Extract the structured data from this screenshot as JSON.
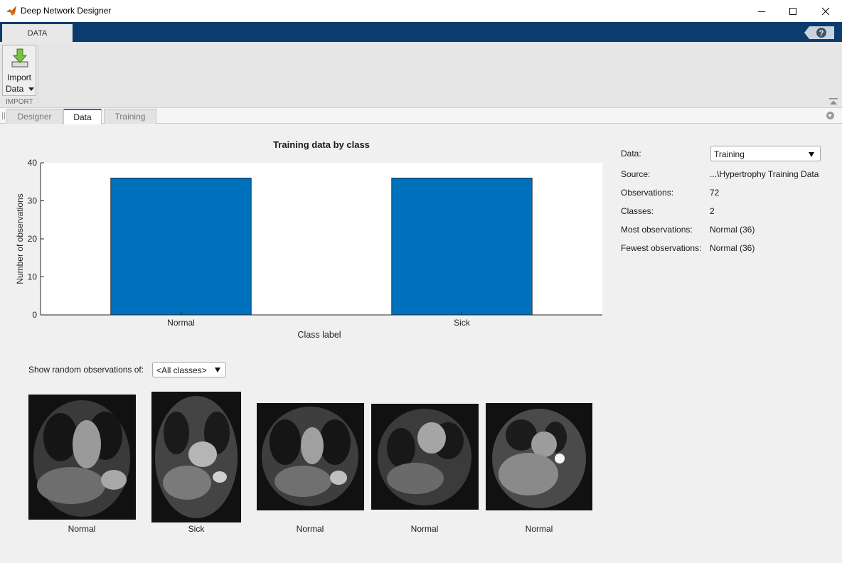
{
  "window": {
    "title": "Deep Network Designer"
  },
  "ribbon": {
    "tab": "DATA",
    "import_label_1": "Import",
    "import_label_2": "Data",
    "section_label": "IMPORT"
  },
  "doc_tabs": [
    {
      "label": "Designer",
      "active": false
    },
    {
      "label": "Data",
      "active": true
    },
    {
      "label": "Training",
      "active": false
    }
  ],
  "chart_data": {
    "type": "bar",
    "title": "Training data by class",
    "xlabel": "Class label",
    "ylabel": "Number of observations",
    "categories": [
      "Normal",
      "Sick"
    ],
    "values": [
      36,
      36
    ],
    "ylim": [
      0,
      40
    ],
    "yticks": [
      0,
      10,
      20,
      30,
      40
    ],
    "bar_color": "#0072bd",
    "grid": false
  },
  "info": {
    "data_label": "Data:",
    "data_value": "Training",
    "rows": [
      {
        "key": "Source:",
        "value": "...\\Hypertrophy Training Data"
      },
      {
        "key": "Observations:",
        "value": "72"
      },
      {
        "key": "Classes:",
        "value": "2"
      },
      {
        "key": "Most observations:",
        "value": "Normal (36)"
      },
      {
        "key": "Fewest observations:",
        "value": "Normal (36)"
      }
    ]
  },
  "observations": {
    "label": "Show random observations of:",
    "selected": "<All classes>",
    "items": [
      {
        "label": "Normal"
      },
      {
        "label": "Sick"
      },
      {
        "label": "Normal"
      },
      {
        "label": "Normal"
      },
      {
        "label": "Normal"
      }
    ]
  },
  "colors": {
    "ribbon_blue": "#0c3c6e",
    "bar_blue": "#0072bd",
    "active_tab_accent": "#1f6cb0"
  }
}
